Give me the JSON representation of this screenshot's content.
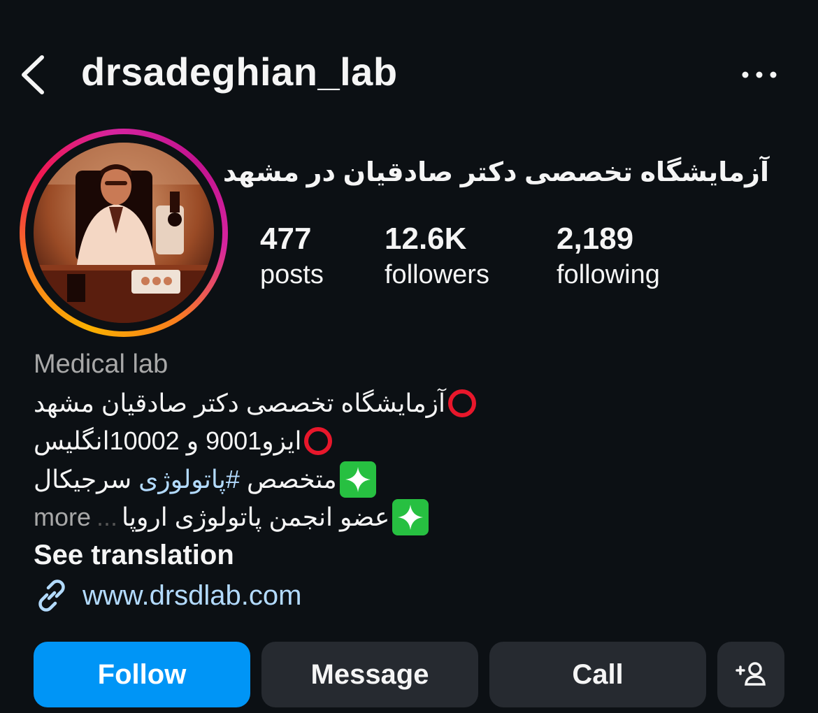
{
  "header": {
    "username": "drsadeghian_lab",
    "back_icon": "chevron-left-icon",
    "more_icon": "more-horizontal-icon"
  },
  "profile": {
    "full_name": "آزمایشگاه تخصصی دکتر صادقیان در مشهد",
    "avatar": "profile-photo"
  },
  "stats": [
    {
      "value": "477",
      "label": "posts"
    },
    {
      "value": "12.6K",
      "label": "followers"
    },
    {
      "value": "2,189",
      "label": "following"
    }
  ],
  "bio": {
    "category": "Medical lab",
    "line1": "آزمایشگاه تخصصی دکتر صادقیان مشهد",
    "line2": "ایزو9001 و 10002انگلیس",
    "line3_before": "متخصص",
    "line3_hashtag": "#پاتولوژی",
    "line3_after": "سرجیکال",
    "line4": "عضو انجمن پاتولوژی اروپا",
    "ellipsis": "...",
    "more": "more",
    "see_translation": "See translation",
    "link": "www.drsdlab.com"
  },
  "actions": {
    "follow": "Follow",
    "message": "Message",
    "call": "Call",
    "add_user_icon": "add-person-icon"
  },
  "colors": {
    "background": "#0c1014",
    "follow_button": "#0095f6",
    "secondary_button": "#262a30",
    "link": "#b3dbff",
    "category": "#a8a8a8",
    "red_circle": "#e8172b",
    "sparkle_box": "#27c041"
  }
}
